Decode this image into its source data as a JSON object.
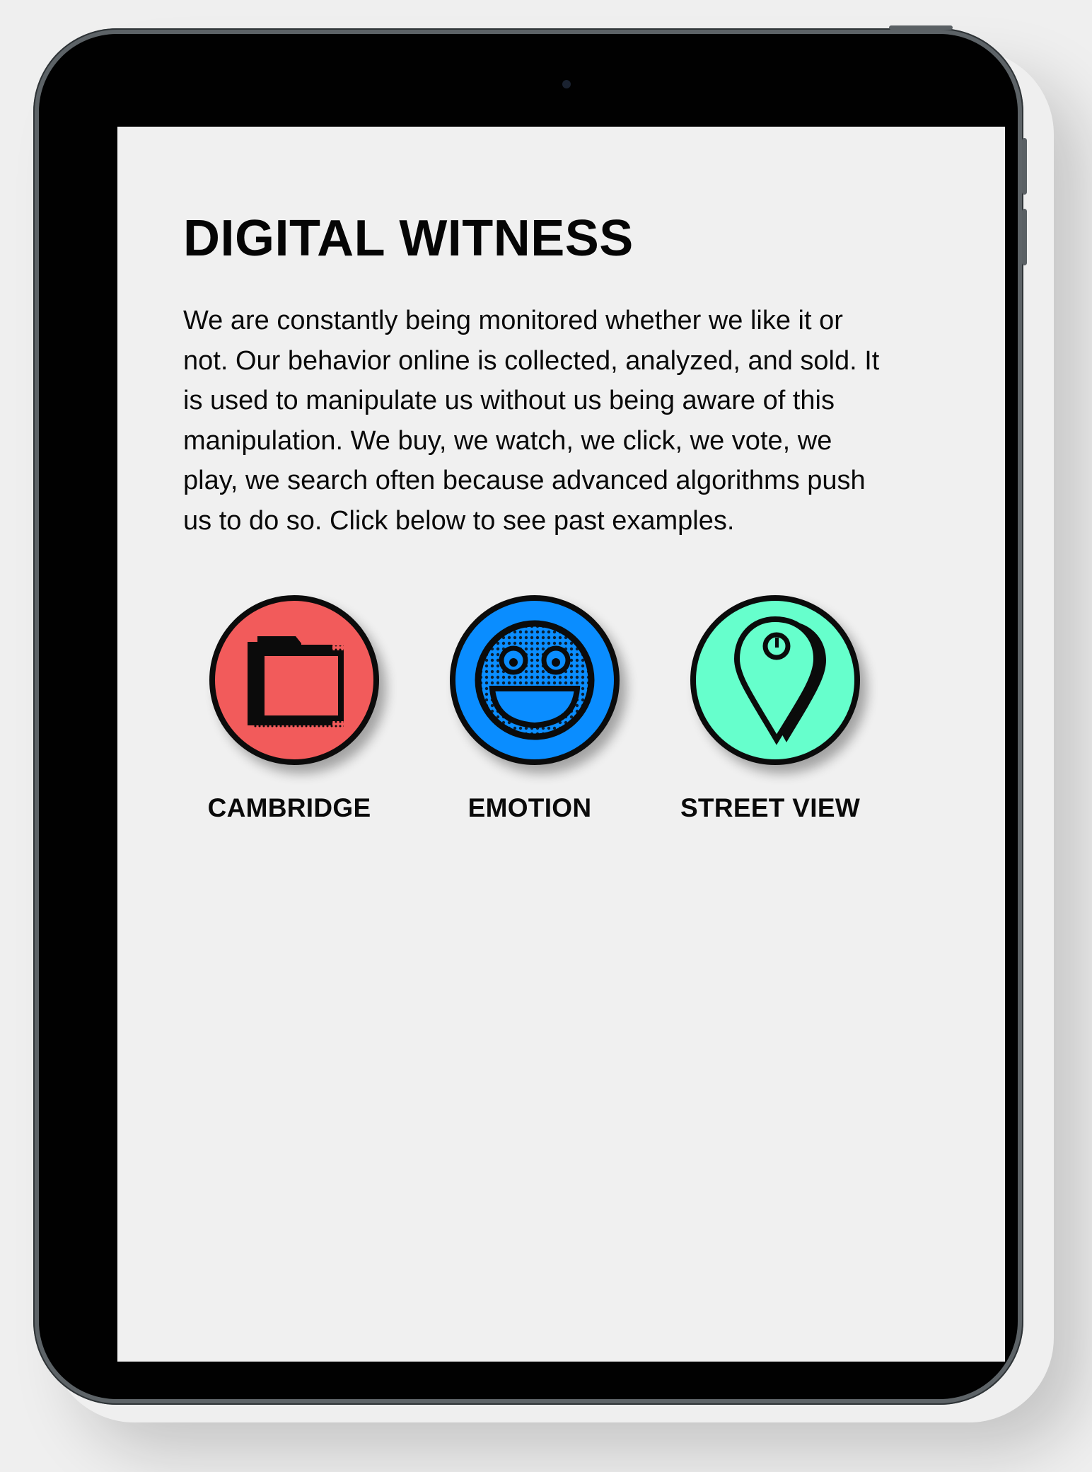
{
  "page": {
    "title": "DIGITAL WITNESS",
    "intro": "We are constantly being monitored whether we like it or not. Our behavior online is collected, analyzed, and sold. It is used to manipulate us without us being aware of this manipulation. We buy, we watch, we click, we vote, we play, we search often because advanced algorithms push us to do so. Click below to see past examples."
  },
  "categories": [
    {
      "label": "CAMBRIDGE",
      "icon": "folder-icon",
      "color": "#f25b5b"
    },
    {
      "label": "EMOTION",
      "icon": "smiley-face-icon",
      "color": "#0a8dff"
    },
    {
      "label": "STREET VIEW",
      "icon": "map-pin-icon",
      "color": "#66ffcc"
    }
  ]
}
